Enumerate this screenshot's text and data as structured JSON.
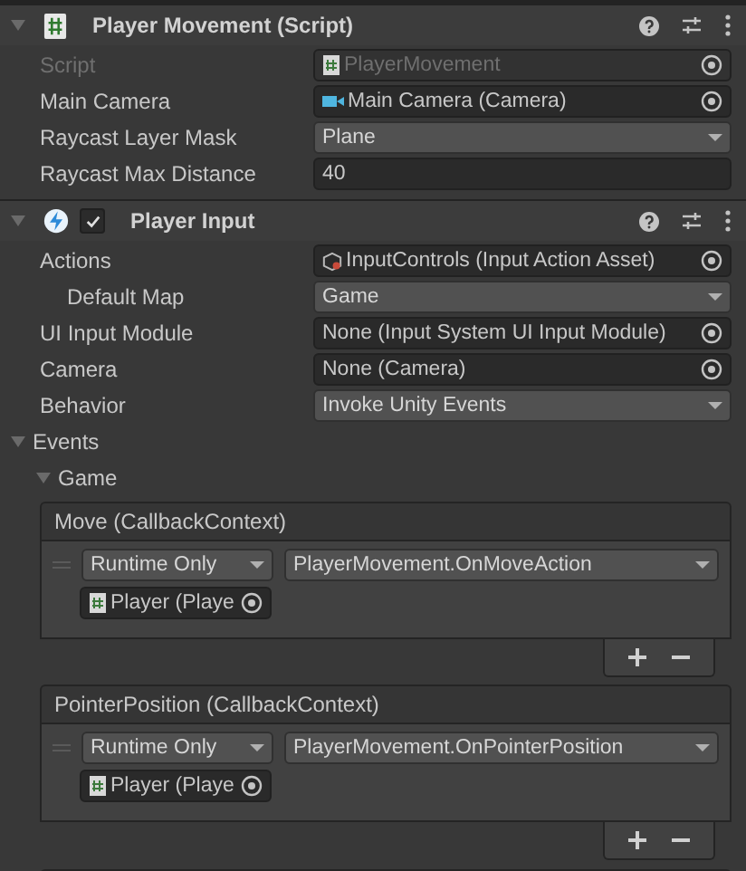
{
  "components": [
    {
      "kind": "script",
      "title": "Player Movement (Script)",
      "expanded": true,
      "fields": [
        {
          "label": "Script",
          "kind": "script-ref",
          "value": "PlayerMovement",
          "disabled": true,
          "indented": false
        },
        {
          "label": "Main Camera",
          "kind": "camera-ref",
          "value": "Main Camera (Camera)",
          "disabled": false,
          "indented": false
        },
        {
          "label": "Raycast Layer Mask",
          "kind": "dropdown",
          "value": "Plane",
          "disabled": false,
          "indented": false
        },
        {
          "label": "Raycast Max Distance",
          "kind": "text",
          "value": "40",
          "disabled": false,
          "indented": false
        }
      ]
    },
    {
      "kind": "input",
      "title": "Player Input",
      "expanded": true,
      "enabled": true,
      "fields": [
        {
          "label": "Actions",
          "kind": "asset-ref",
          "value": "InputControls (Input Action Asset)",
          "disabled": false,
          "indented": false
        },
        {
          "label": "Default Map",
          "kind": "dropdown",
          "value": "Game",
          "disabled": false,
          "indented": true
        },
        {
          "label": "UI Input Module",
          "kind": "object",
          "value": "None (Input System UI Input Module)",
          "disabled": false,
          "indented": false
        },
        {
          "label": "Camera",
          "kind": "object",
          "value": "None (Camera)",
          "disabled": false,
          "indented": false
        },
        {
          "label": "Behavior",
          "kind": "dropdown",
          "value": "Invoke Unity Events",
          "disabled": false,
          "indented": false
        }
      ],
      "events": {
        "label": "Events",
        "expanded": true,
        "group": {
          "label": "Game",
          "expanded": true,
          "items": [
            {
              "title": "Move (CallbackContext)",
              "listeners": [
                {
                  "mode": "Runtime Only",
                  "function": "PlayerMovement.OnMoveAction",
                  "target": "Player (Playe"
                }
              ]
            },
            {
              "title": "PointerPosition (CallbackContext)",
              "listeners": [
                {
                  "mode": "Runtime Only",
                  "function": "PlayerMovement.OnPointerPosition",
                  "target": "Player (Playe"
                }
              ]
            }
          ]
        }
      }
    }
  ]
}
